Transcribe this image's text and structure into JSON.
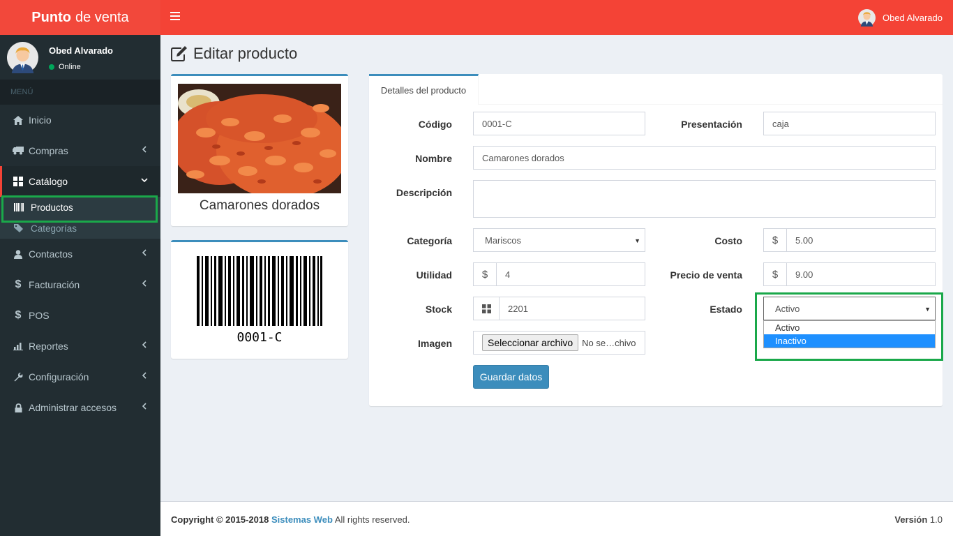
{
  "app": {
    "logo_bold": "Punto",
    "logo_rest": "de venta"
  },
  "header": {
    "user_name": "Obed Alvarado"
  },
  "sidebar": {
    "user_name": "Obed Alvarado",
    "status": "Online",
    "menu_header": "MENÚ",
    "items": [
      {
        "label": "Inicio",
        "icon": "home-icon"
      },
      {
        "label": "Compras",
        "icon": "truck-icon"
      },
      {
        "label": "Catálogo",
        "icon": "th-large-icon"
      },
      {
        "label": "Contactos",
        "icon": "user-icon"
      },
      {
        "label": "Facturación",
        "icon": "dollar-icon"
      },
      {
        "label": "POS",
        "icon": "dollar-icon"
      },
      {
        "label": "Reportes",
        "icon": "bar-chart-icon"
      },
      {
        "label": "Configuración",
        "icon": "wrench-icon"
      },
      {
        "label": "Administrar accesos",
        "icon": "lock-icon"
      }
    ],
    "catalog_sub": [
      {
        "label": "Productos",
        "icon": "barcode-icon"
      },
      {
        "label": "Categorías",
        "icon": "tags-icon"
      }
    ]
  },
  "page": {
    "title": "Editar producto"
  },
  "product_card": {
    "name": "Camarones dorados",
    "image": "shrimp-photo"
  },
  "barcode_card": {
    "code": "0001-C"
  },
  "form": {
    "tab_label": "Detalles del producto",
    "codigo": {
      "label": "Código",
      "value": "0001-C"
    },
    "presentacion": {
      "label": "Presentación",
      "value": "caja"
    },
    "nombre": {
      "label": "Nombre",
      "value": "Camarones dorados"
    },
    "descripcion": {
      "label": "Descripción",
      "value": ""
    },
    "categoria": {
      "label": "Categoría",
      "value": "Mariscos"
    },
    "costo": {
      "label": "Costo",
      "prefix": "$",
      "value": "5.00"
    },
    "utilidad": {
      "label": "Utilidad",
      "prefix": "$",
      "value": "4"
    },
    "precio": {
      "label": "Precio de venta",
      "prefix": "$",
      "value": "9.00"
    },
    "stock": {
      "label": "Stock",
      "value": "2201"
    },
    "estado": {
      "label": "Estado",
      "value": "Activo",
      "options": [
        "Activo",
        "Inactivo"
      ],
      "highlighted_option": "Inactivo"
    },
    "imagen": {
      "label": "Imagen",
      "button": "Seleccionar archivo",
      "file_text": "No se…chivo"
    },
    "save_button": "Guardar datos"
  },
  "footer": {
    "copyright": "Copyright © 2015-2018",
    "company": "Sistemas Web",
    "rights": "All rights reserved.",
    "version_label": "Versión",
    "version": "1.0"
  },
  "colors": {
    "header": "#f44336",
    "sidebar": "#222d32",
    "primary": "#3c8dbc",
    "highlight_box": "#1aa84a"
  }
}
